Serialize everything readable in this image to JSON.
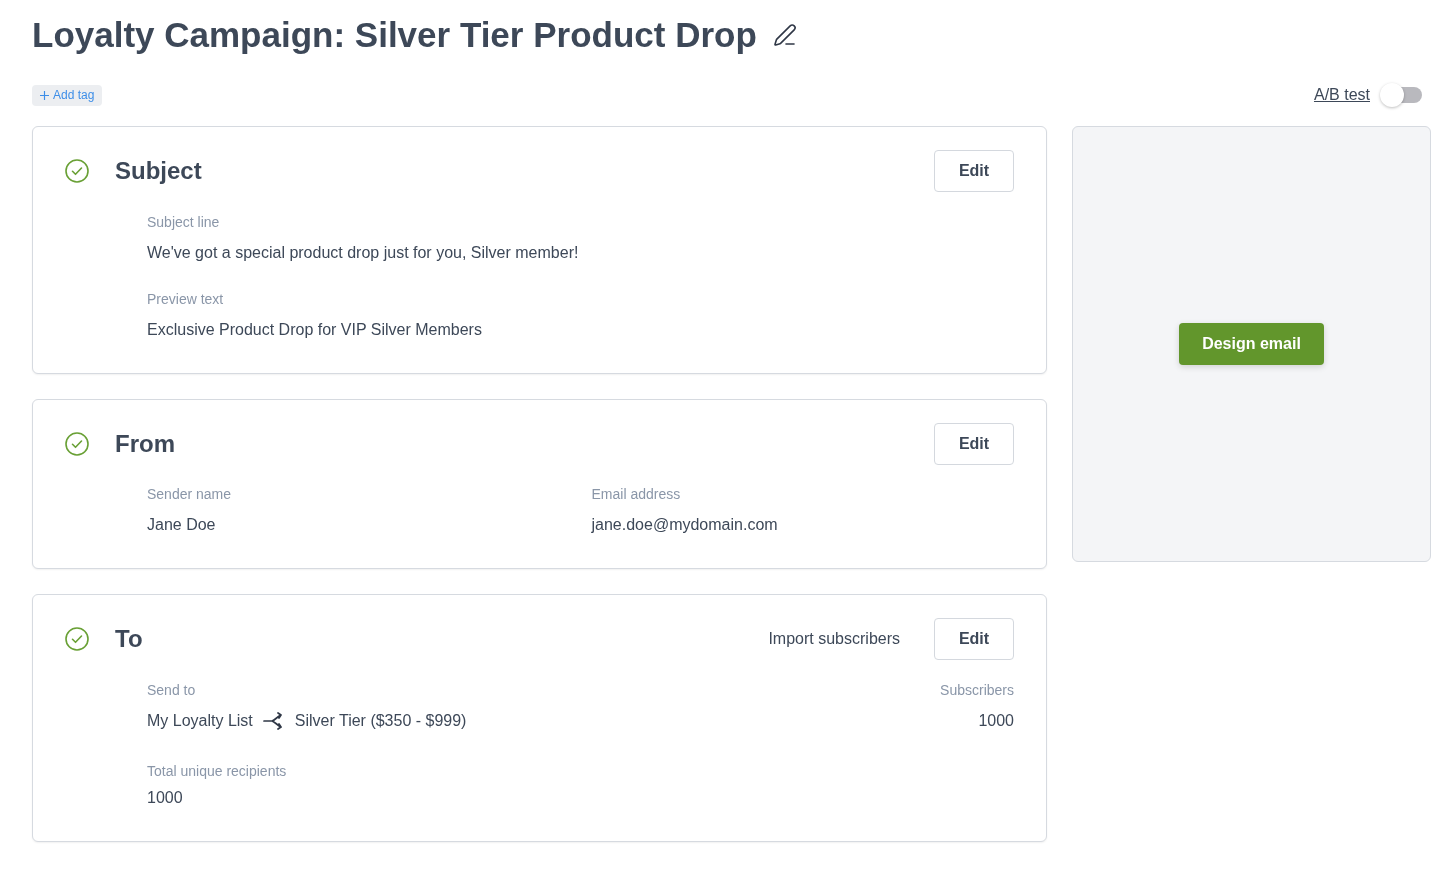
{
  "title": "Loyalty Campaign: Silver Tier Product Drop",
  "add_tag": {
    "label": "Add tag"
  },
  "ab_test": {
    "label": "A/B test",
    "on": false
  },
  "sections": [
    {
      "kind": "stacked",
      "title": "Subject",
      "complete": true,
      "action": "Edit",
      "fields": [
        {
          "label": "Subject line",
          "value": "We've got a special product drop just for you, Silver member!"
        },
        {
          "label": "Preview text",
          "value": "Exclusive Product Drop for VIP Silver Members"
        }
      ]
    },
    {
      "kind": "columns",
      "title": "From",
      "complete": true,
      "action": "Edit",
      "fields": [
        {
          "label": "Sender name",
          "value": "Jane Doe"
        },
        {
          "label": "Email address",
          "value": "jane.doe@mydomain.com"
        }
      ]
    },
    {
      "kind": "recipients",
      "title": "To",
      "complete": true,
      "link": "Import subscribers",
      "action": "Edit",
      "send_to": {
        "label": "Send to",
        "list": "My Loyalty List",
        "segment": "Silver Tier ($350 - $999)"
      },
      "count": {
        "label": "Subscribers",
        "value": "1000"
      },
      "total": {
        "label": "Total unique recipients",
        "value": "1000"
      }
    }
  ],
  "design": {
    "button": "Design email"
  }
}
